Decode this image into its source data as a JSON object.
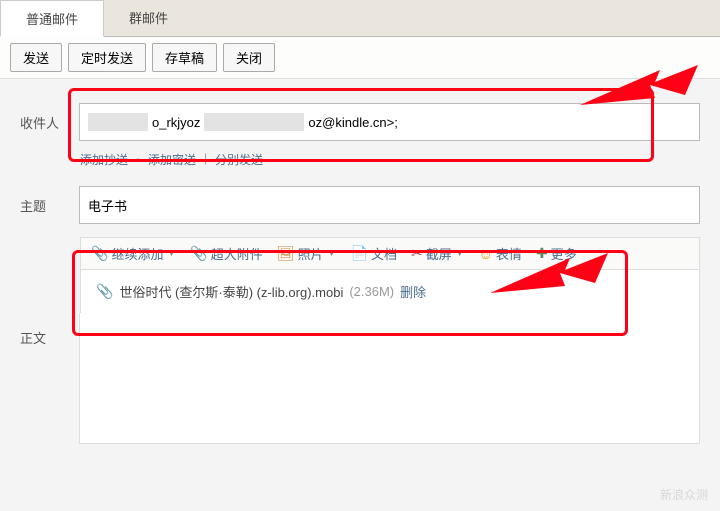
{
  "tabs": {
    "normal": "普通邮件",
    "group": "群邮件"
  },
  "toolbar": {
    "send": "发送",
    "timed_send": "定时发送",
    "save_draft": "存草稿",
    "close": "关闭"
  },
  "recipient": {
    "label": "收件人",
    "part1": "o_rkjyoz",
    "part2": "oz@kindle.cn>;"
  },
  "sublinks": {
    "add_cc": "添加抄送",
    "add_bcc": "添加密送",
    "separate_send": "分别发送"
  },
  "subject": {
    "label": "主题",
    "value": "电子书"
  },
  "attach_bar": {
    "continue_add": "继续添加",
    "big_attach": "超大附件",
    "photo": "照片",
    "doc": "文档",
    "screenshot": "截屏",
    "emoji": "表情",
    "more": "更多"
  },
  "file": {
    "name": "世俗时代 (查尔斯·泰勒) (z-lib.org).mobi",
    "size": "(2.36M)",
    "delete": "删除"
  },
  "body_label": "正文",
  "watermark": "新浪众测"
}
